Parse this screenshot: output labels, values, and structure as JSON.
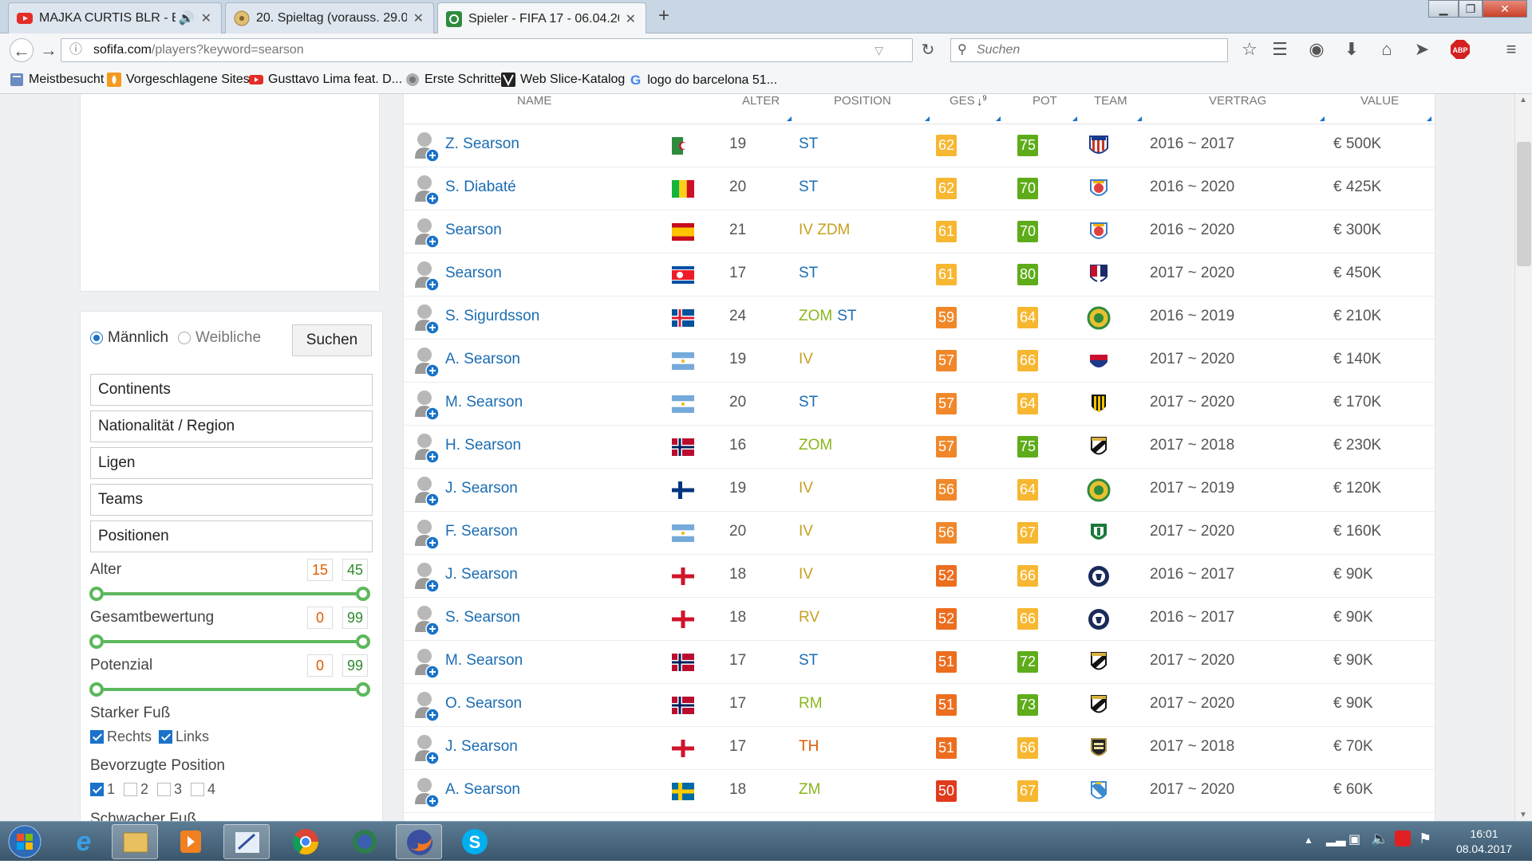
{
  "browser": {
    "tabs": [
      {
        "title": "MAJKA CURTIS BLR - B...",
        "icon": "youtube-icon",
        "audio": true
      },
      {
        "title": "20. Spieltag (vorauss. 29.03...",
        "icon": "soccer-ball-icon"
      },
      {
        "title": "Spieler - FIFA 17 - 06.04.20...",
        "icon": "sofifa-icon",
        "active": true
      }
    ],
    "url_host": "sofifa.com",
    "url_path": "/players?keyword=searson",
    "search_placeholder": "Suchen",
    "bookmarks": [
      {
        "label": "Meistbesucht",
        "icon": "bookmark-icon"
      },
      {
        "label": "Vorgeschlagene Sites",
        "icon": "flame-icon"
      },
      {
        "label": "Gusttavo Lima feat. D...",
        "icon": "youtube-icon"
      },
      {
        "label": "Erste Schritte",
        "icon": "globe-icon"
      },
      {
        "label": "Web Slice-Katalog",
        "icon": "webslice-icon"
      },
      {
        "label": "logo do barcelona 51...",
        "icon": "google-icon"
      }
    ]
  },
  "filter": {
    "gender_male": "Männlich",
    "gender_female": "Weibliche",
    "search_button": "Suchen",
    "boxes": [
      "Continents",
      "Nationalität / Region",
      "Ligen",
      "Teams",
      "Positionen"
    ],
    "ranges": [
      {
        "label": "Alter",
        "min": "15",
        "max": "45"
      },
      {
        "label": "Gesamtbewertung",
        "min": "0",
        "max": "99"
      },
      {
        "label": "Potenzial",
        "min": "0",
        "max": "99"
      }
    ],
    "strong_foot_label": "Starker Fuß",
    "foot_right": "Rechts",
    "foot_left": "Links",
    "preferred_position_label": "Bevorzugte Position",
    "pref_positions": [
      "1",
      "2",
      "3",
      "4"
    ],
    "weak_foot_label": "Schwacher Fuß"
  },
  "table": {
    "headers": {
      "name": "NAME",
      "age": "ALTER",
      "position": "POSITION",
      "overall": "GES",
      "potential": "POT",
      "team": "TEAM",
      "contract": "VERTRAG",
      "value": "VALUE"
    },
    "rows": [
      {
        "name": "Z. Searson",
        "flag": "algeria",
        "age": "19",
        "pos": [
          {
            "t": "ST",
            "c": "#1b6db3"
          }
        ],
        "ges": "62",
        "pot": "75",
        "crest": "atletico",
        "contract": "2016 ~ 2017",
        "value": "€ 500K"
      },
      {
        "name": "S. Diabaté",
        "flag": "mali",
        "age": "20",
        "pos": [
          {
            "t": "ST",
            "c": "#1b6db3"
          }
        ],
        "ges": "62",
        "pot": "70",
        "crest": "shield-blue-red",
        "contract": "2016 ~ 2020",
        "value": "€ 425K"
      },
      {
        "name": "Searson",
        "flag": "spain",
        "age": "21",
        "pos": [
          {
            "t": "IV ZDM",
            "c": "#c8a020"
          }
        ],
        "ges": "61",
        "pot": "70",
        "crest": "shield-blue-red",
        "contract": "2016 ~ 2020",
        "value": "€ 300K"
      },
      {
        "name": "Searson",
        "flag": "north-korea",
        "age": "17",
        "pos": [
          {
            "t": "ST",
            "c": "#1b6db3"
          }
        ],
        "ges": "61",
        "pot": "80",
        "crest": "cagliari",
        "contract": "2017 ~ 2020",
        "value": "€ 450K"
      },
      {
        "name": "S. Sigurdsson",
        "flag": "iceland",
        "age": "24",
        "pos": [
          {
            "t": "ZOM",
            "c": "#8ab61e"
          },
          {
            "t": "ST",
            "c": "#1b6db3"
          }
        ],
        "ges": "59",
        "pot": "64",
        "crest": "round-green",
        "contract": "2016 ~ 2019",
        "value": "€ 210K"
      },
      {
        "name": "A. Searson",
        "flag": "argentina",
        "age": "19",
        "pos": [
          {
            "t": "IV",
            "c": "#c8a020"
          }
        ],
        "ges": "57",
        "pot": "66",
        "crest": "shield-red-blue",
        "contract": "2017 ~ 2020",
        "value": "€ 140K"
      },
      {
        "name": "M. Searson",
        "flag": "argentina",
        "age": "20",
        "pos": [
          {
            "t": "ST",
            "c": "#1b6db3"
          }
        ],
        "ges": "57",
        "pot": "64",
        "crest": "yellow-black",
        "contract": "2017 ~ 2020",
        "value": "€ 170K"
      },
      {
        "name": "H. Searson",
        "flag": "norway",
        "age": "16",
        "pos": [
          {
            "t": "ZOM",
            "c": "#8ab61e"
          }
        ],
        "ges": "57",
        "pot": "75",
        "crest": "black-white-diag",
        "contract": "2017 ~ 2018",
        "value": "€ 230K"
      },
      {
        "name": "J. Searson",
        "flag": "finland",
        "age": "19",
        "pos": [
          {
            "t": "IV",
            "c": "#c8a020"
          }
        ],
        "ges": "56",
        "pot": "64",
        "crest": "round-green",
        "contract": "2017 ~ 2019",
        "value": "€ 120K"
      },
      {
        "name": "F. Searson",
        "flag": "argentina",
        "age": "20",
        "pos": [
          {
            "t": "IV",
            "c": "#c8a020"
          }
        ],
        "ges": "56",
        "pot": "67",
        "crest": "green-shield",
        "contract": "2017 ~ 2020",
        "value": "€ 160K"
      },
      {
        "name": "J. Searson",
        "flag": "england",
        "age": "18",
        "pos": [
          {
            "t": "IV",
            "c": "#c8a020"
          }
        ],
        "ges": "52",
        "pot": "66",
        "crest": "round-navy",
        "contract": "2016 ~ 2017",
        "value": "€ 90K"
      },
      {
        "name": "S. Searson",
        "flag": "england",
        "age": "18",
        "pos": [
          {
            "t": "RV",
            "c": "#c8a020"
          }
        ],
        "ges": "52",
        "pot": "66",
        "crest": "round-navy",
        "contract": "2016 ~ 2017",
        "value": "€ 90K"
      },
      {
        "name": "M. Searson",
        "flag": "norway",
        "age": "17",
        "pos": [
          {
            "t": "ST",
            "c": "#1b6db3"
          }
        ],
        "ges": "51",
        "pot": "72",
        "crest": "black-white-diag",
        "contract": "2017 ~ 2020",
        "value": "€ 90K"
      },
      {
        "name": "O. Searson",
        "flag": "norway",
        "age": "17",
        "pos": [
          {
            "t": "RM",
            "c": "#8ab61e"
          }
        ],
        "ges": "51",
        "pot": "73",
        "crest": "black-white-diag",
        "contract": "2017 ~ 2020",
        "value": "€ 90K"
      },
      {
        "name": "J. Searson",
        "flag": "england",
        "age": "17",
        "pos": [
          {
            "t": "TH",
            "c": "#e05a00"
          }
        ],
        "ges": "51",
        "pot": "66",
        "crest": "black-gold",
        "contract": "2017 ~ 2018",
        "value": "€ 70K"
      },
      {
        "name": "A. Searson",
        "flag": "sweden",
        "age": "18",
        "pos": [
          {
            "t": "ZM",
            "c": "#8ab61e"
          }
        ],
        "ges": "50",
        "pot": "67",
        "crest": "blue-white-diag",
        "contract": "2017 ~ 2020",
        "value": "€ 60K"
      }
    ]
  },
  "taskbar": {
    "time": "16:01",
    "date": "08.04.2017"
  }
}
